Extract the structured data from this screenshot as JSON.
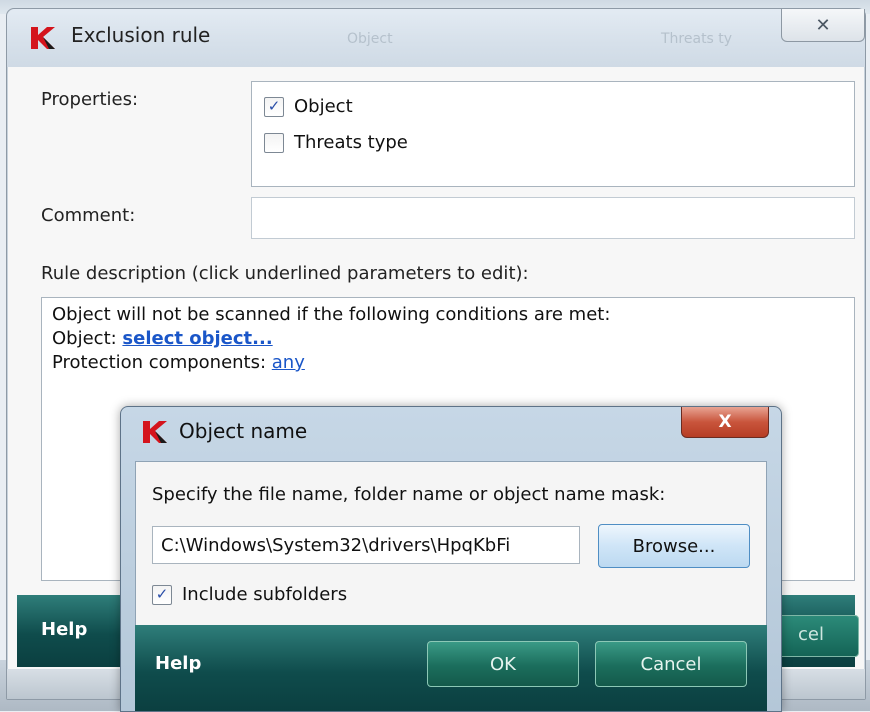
{
  "main_dialog": {
    "title": "Exclusion rule",
    "close_glyph": "✕",
    "background_tab_labels": [
      "Object",
      "Threats ty"
    ],
    "properties_label": "Properties:",
    "properties": [
      {
        "label": "Object",
        "checked": true
      },
      {
        "label": "Threats type",
        "checked": false
      }
    ],
    "comment_label": "Comment:",
    "comment_value": "",
    "rule_description_label": "Rule description (click underlined parameters to edit):",
    "description": {
      "line1": "Object will not be scanned if the following conditions are met:",
      "object_prefix": "Object: ",
      "object_link": "select object...",
      "components_prefix": "Protection components: ",
      "components_link": "any"
    },
    "footer": {
      "help_label": "Help",
      "partial_button_label": "cel"
    }
  },
  "object_name_dialog": {
    "title": "Object name",
    "close_glyph": "X",
    "instruction": "Specify the file name, folder name or object name mask:",
    "path_value": "C:\\Windows\\System32\\drivers\\HpqKbFi",
    "browse_label": "Browse...",
    "include_subfolders_label": "Include subfolders",
    "include_subfolders_checked": true,
    "footer": {
      "help_label": "Help",
      "ok_label": "OK",
      "cancel_label": "Cancel"
    }
  },
  "colors": {
    "footer_teal": "#0f4c4c",
    "link_blue": "#1a56c8",
    "logo_red": "#d4141c",
    "close_red": "#c9553c"
  },
  "icons": {
    "app_logo": "kaspersky-k-icon",
    "checkmark": "✓"
  }
}
